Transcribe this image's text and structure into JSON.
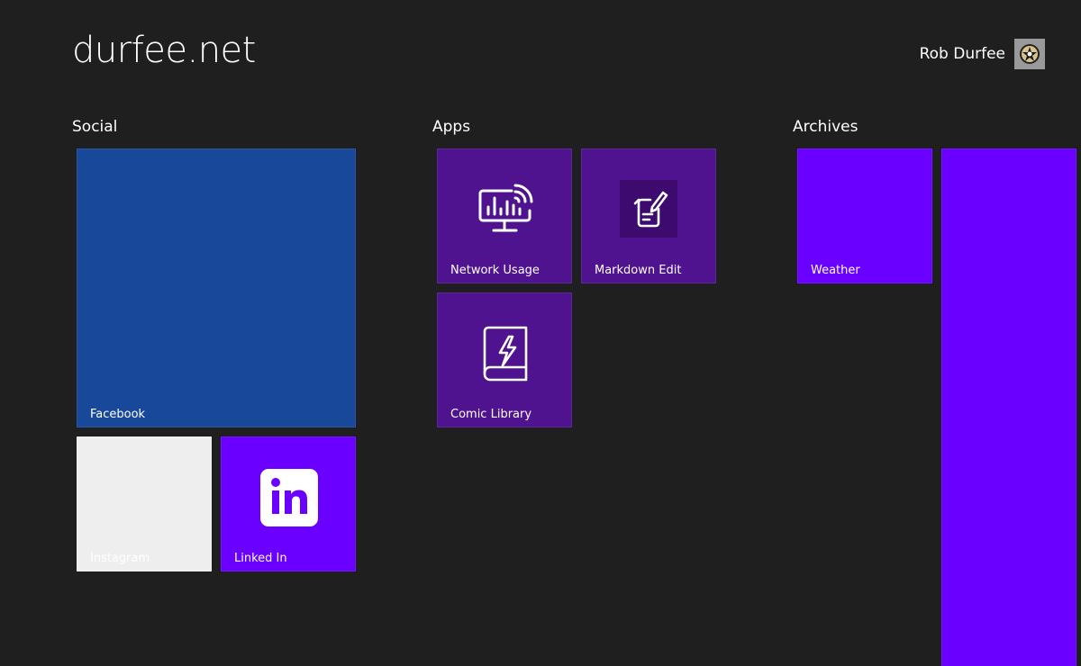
{
  "header": {
    "site_title": "durfee.net",
    "user_name": "Rob Durfee",
    "avatar_icon": "user-avatar"
  },
  "groups": [
    {
      "title": "Social",
      "tiles": [
        {
          "label": "Facebook",
          "color": "#17489a"
        },
        {
          "label": "Instagram",
          "color": "#eeeeee"
        },
        {
          "label": "Linked In",
          "color": "#6a00ff",
          "icon": "linkedin-icon"
        }
      ]
    },
    {
      "title": "Apps",
      "tiles": [
        {
          "label": "Network Usage",
          "color": "#4f1390",
          "icon": "network-monitor-icon"
        },
        {
          "label": "Markdown Edit",
          "color": "#4f1390",
          "icon": "markdown-edit-icon"
        },
        {
          "label": "Comic Library",
          "color": "#4f1390",
          "icon": "comic-book-icon"
        }
      ]
    },
    {
      "title": "Archives",
      "tiles": [
        {
          "label": "Weather",
          "color": "#6a00ff"
        },
        {
          "label": "",
          "color": "#6a00ff"
        }
      ]
    }
  ]
}
